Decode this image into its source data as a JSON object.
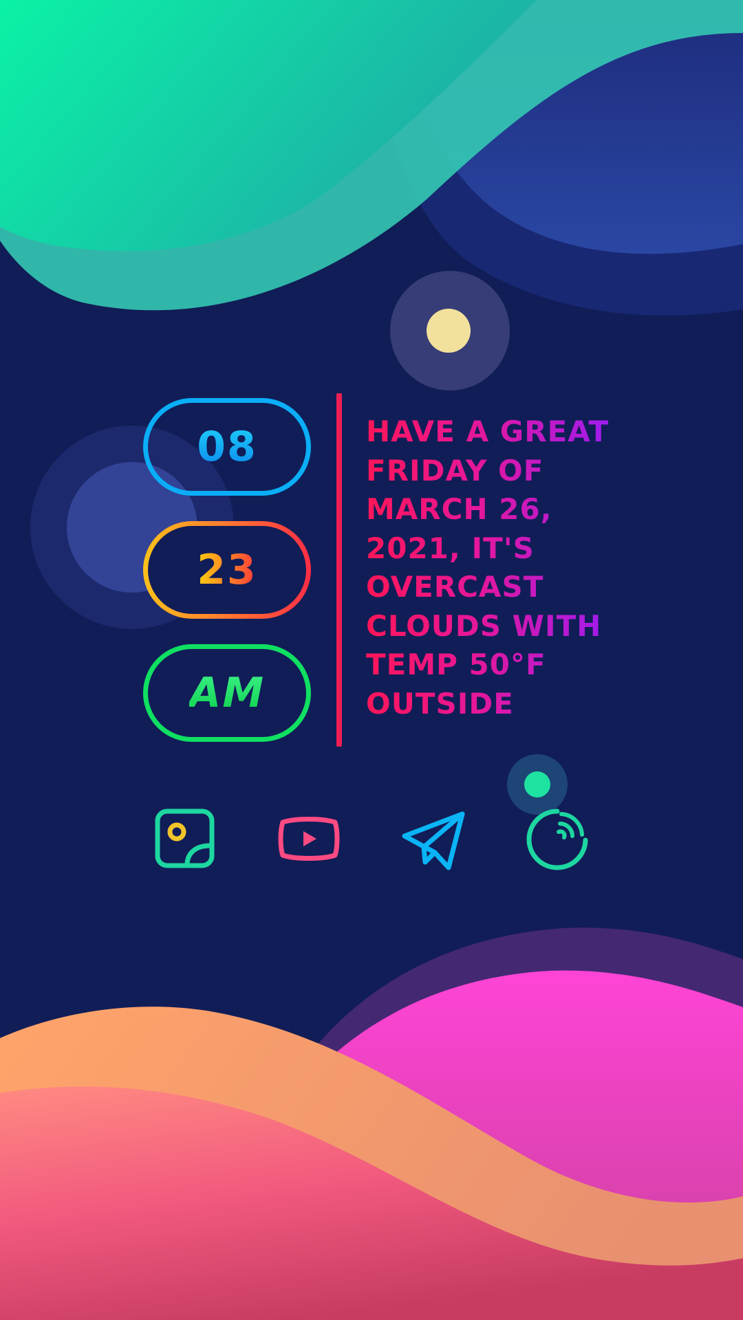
{
  "clock": {
    "hour": "08",
    "minute": "23",
    "meridiem": "AM"
  },
  "message": "Have a great Friday of March 26, 2021, it's overcast clouds with temp 50°F outside",
  "dock": [
    {
      "name": "gallery",
      "icon": "gallery-icon",
      "color": "#1dd7a0"
    },
    {
      "name": "youtube",
      "icon": "play-video-icon",
      "color": "#ff4a82"
    },
    {
      "name": "telegram",
      "icon": "paper-plane-icon",
      "color": "#0ab4f5"
    },
    {
      "name": "music",
      "icon": "music-disc-icon",
      "color": "#1dd7a0"
    }
  ],
  "colors": {
    "background": "#111d57",
    "accent_divider": "#ee1f55",
    "teal_wave": "#18e6b4",
    "pink_wave": "#ff44d6",
    "sun": "#f1e19c"
  }
}
